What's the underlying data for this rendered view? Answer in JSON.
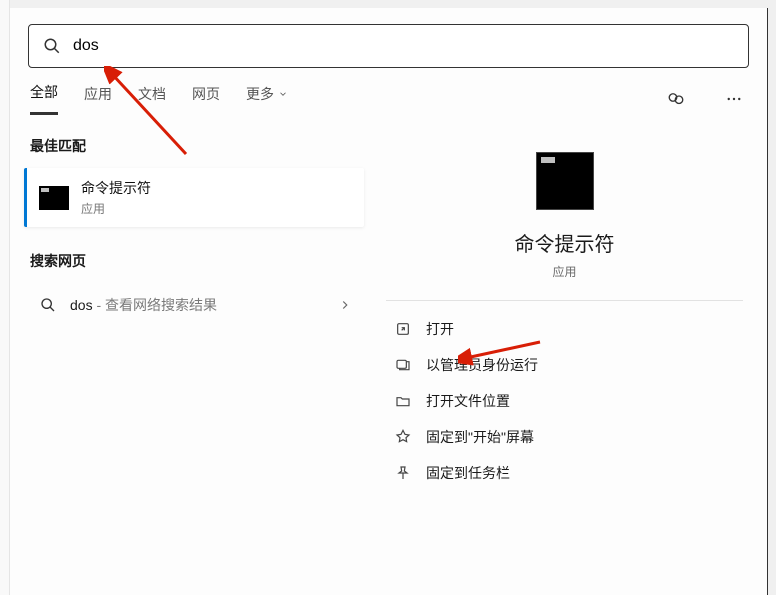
{
  "search": {
    "query": "dos"
  },
  "tabs": {
    "items": [
      "全部",
      "应用",
      "文档",
      "网页",
      "更多"
    ]
  },
  "leftPanel": {
    "bestMatchTitle": "最佳匹配",
    "bestMatch": {
      "title": "命令提示符",
      "subtitle": "应用"
    },
    "webTitle": "搜索网页",
    "webItem": {
      "term": "dos",
      "suffix": " - 查看网络搜索结果"
    }
  },
  "detail": {
    "title": "命令提示符",
    "subtitle": "应用",
    "actions": [
      "打开",
      "以管理员身份运行",
      "打开文件位置",
      "固定到\"开始\"屏幕",
      "固定到任务栏"
    ]
  }
}
